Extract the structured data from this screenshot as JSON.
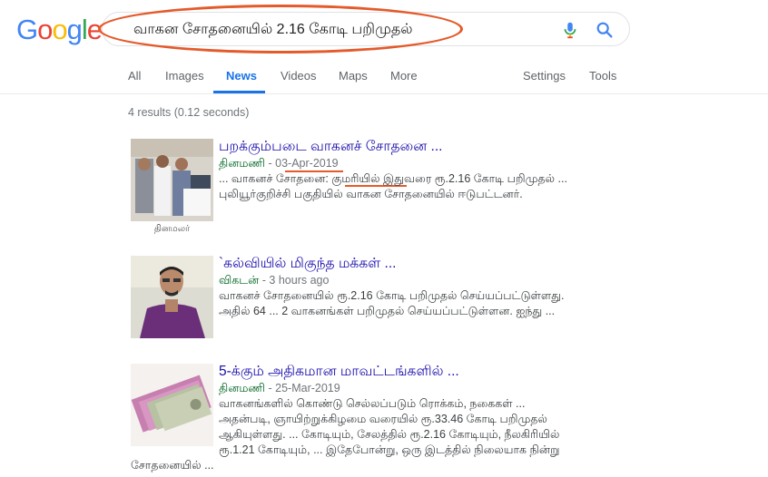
{
  "logo": {
    "letters": [
      "G",
      "o",
      "o",
      "g",
      "l",
      "e"
    ],
    "colors": [
      "#4285F4",
      "#EA4335",
      "#FBBC05",
      "#4285F4",
      "#34A853",
      "#EA4335"
    ]
  },
  "search": {
    "query": "வாகன சோதனையில் 2.16 கோடி பறிமுதல்"
  },
  "tabs": [
    {
      "label": "All",
      "active": false
    },
    {
      "label": "Images",
      "active": false
    },
    {
      "label": "News",
      "active": true
    },
    {
      "label": "Videos",
      "active": false
    },
    {
      "label": "Maps",
      "active": false
    },
    {
      "label": "More",
      "active": false
    }
  ],
  "settings_label": "Settings",
  "tools_label": "Tools",
  "stats": "4 results (0.12 seconds)",
  "results": [
    {
      "title": "பறக்கும்படை வாகனச் சோதனை ...",
      "source": "தினமணி",
      "date": "03-Apr-2019",
      "snippet1": "... வாகனச் சோதனை: குமரியில் இதுவரை ரூ.2.16 கோடி பறிமுதல் ...",
      "snippet2": "புலியூர்குறிச்சி பகுதியில் வாகன சோதனையில் ஈடுபட்டனர்.",
      "image_caption": "தினமலர்"
    },
    {
      "title": "`கல்வியில் மிகுந்த மக்கள் ...",
      "source": "விகடன்",
      "date": "3 hours ago",
      "snippet1": "வாகனச் சோதனையில் ரூ.2.16 கோடி பறிமுதல் செய்யப்பட்டுள்ளது.",
      "snippet2": "அதில் 64 ... 2 வாகனங்கள் பறிமுதல் செய்யப்பட்டுள்ளன. ஐந்து ..."
    },
    {
      "title": "5-க்கும் அதிகமான மாவட்டங்களில் ...",
      "source": "தினமணி",
      "date": "25-Mar-2019",
      "snippet1": "வாகனங்களில் கொண்டு செல்லப்படும் ரொக்கம், நகைகள் ...",
      "snippet2": "அதன்படி, ஞாயிற்றுக்கிழமை வரையில் ரூ.33.46 கோடி பறிமுதல்",
      "snippet3": "ஆகியுள்ளது. ... கோடியும், சேலத்தில் ரூ.2.16 கோடியும், நீலகிரியில்",
      "snippet4": "ரூ.1.21 கோடியும், ... இதேபோன்று, ஒரு இடத்தில் நிலையாக நின்று",
      "snippet5": "சோதனையில் ..."
    }
  ]
}
